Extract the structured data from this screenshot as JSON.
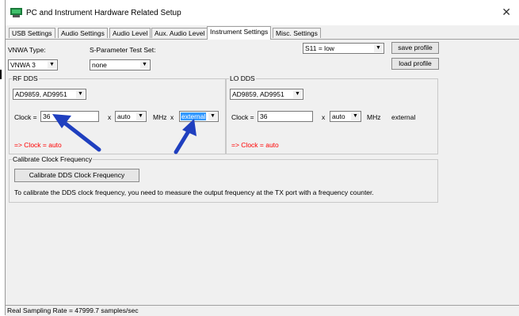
{
  "window": {
    "title": "PC and Instrument Hardware Related Setup",
    "close_glyph": "✕"
  },
  "tabs": [
    "USB Settings",
    "Audio Settings",
    "Audio Level",
    "Aux. Audio Level",
    "Instrument Settings",
    "Misc. Settings"
  ],
  "active_tab": "Instrument Settings",
  "top": {
    "vnwa_type_label": "VNWA Type:",
    "vnwa_type_value": "VNWA 3",
    "sparam_label": "S-Parameter Test Set:",
    "sparam_value": "none",
    "s11_value": "S11 = low",
    "save_profile": "save profile",
    "load_profile": "load profile"
  },
  "rf_dds": {
    "title": "RF DDS",
    "chip": "AD9859, AD9951",
    "clock_label": "Clock =",
    "clock_value": "36",
    "x1": "x",
    "multiplier": "auto",
    "unit": "MHz",
    "x2": "x",
    "source": "external",
    "result": "=> Clock = auto"
  },
  "lo_dds": {
    "title": "LO DDS",
    "chip": "AD9859, AD9951",
    "clock_label": "Clock =",
    "clock_value": "36",
    "x1": "x",
    "multiplier": "auto",
    "unit": "MHz",
    "source": "external",
    "result": "=> Clock = auto"
  },
  "calibrate": {
    "title": "Calibrate Clock Frequency",
    "button": "Calibrate DDS Clock Frequency",
    "hint": "To calibrate the DDS clock frequency, you need to measure the output frequency at the TX port with a frequency counter."
  },
  "status": "Real Sampling Rate = 47999.7 samples/sec",
  "colors": {
    "annotation_arrow": "#1f3fbf",
    "error_text": "#ff0000",
    "selection": "#3399ff"
  }
}
